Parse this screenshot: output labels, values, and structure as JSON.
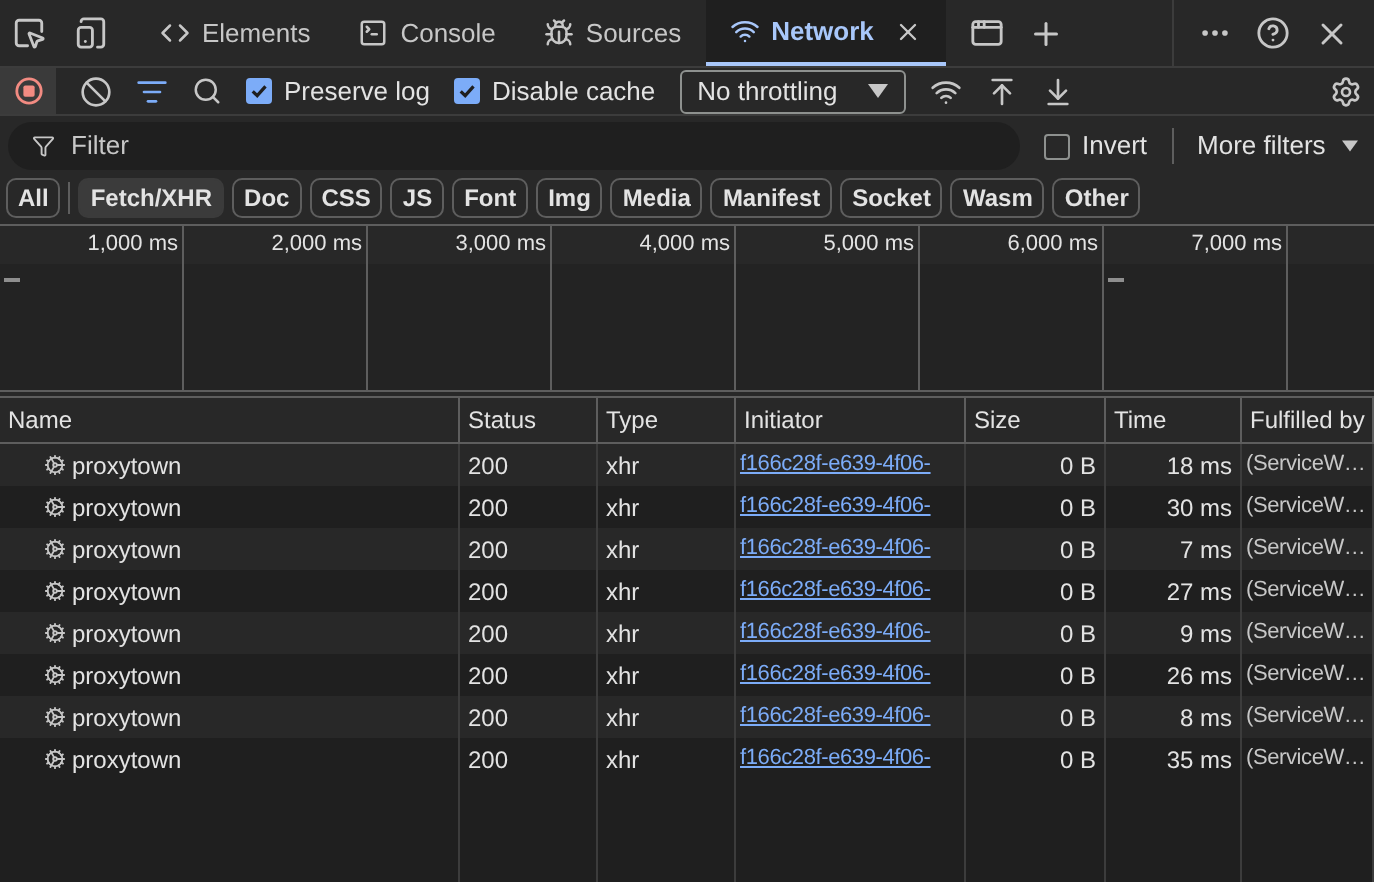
{
  "tabs": [
    {
      "label": "Elements",
      "kind": "code",
      "selected": false
    },
    {
      "label": "Console",
      "kind": "console",
      "selected": false
    },
    {
      "label": "Sources",
      "kind": "bug",
      "selected": false
    },
    {
      "label": "Network",
      "kind": "wifi",
      "selected": true,
      "closable": true
    }
  ],
  "toolbar": {
    "recording": true,
    "preserve_log": {
      "label": "Preserve log",
      "checked": true
    },
    "disable_cache": {
      "label": "Disable cache",
      "checked": true
    },
    "throttling": {
      "value": "No throttling"
    }
  },
  "filter": {
    "placeholder": "Filter",
    "invert": {
      "label": "Invert",
      "checked": false
    },
    "more_filters": "More filters"
  },
  "type_filters": [
    {
      "label": "All",
      "selected": false
    },
    {
      "label": "Fetch/XHR",
      "selected": true
    },
    {
      "label": "Doc",
      "selected": false
    },
    {
      "label": "CSS",
      "selected": false
    },
    {
      "label": "JS",
      "selected": false
    },
    {
      "label": "Font",
      "selected": false
    },
    {
      "label": "Img",
      "selected": false
    },
    {
      "label": "Media",
      "selected": false
    },
    {
      "label": "Manifest",
      "selected": false
    },
    {
      "label": "Socket",
      "selected": false
    },
    {
      "label": "Wasm",
      "selected": false
    },
    {
      "label": "Other",
      "selected": false
    }
  ],
  "timeline": {
    "ticks": [
      "1,000 ms",
      "2,000 ms",
      "3,000 ms",
      "4,000 ms",
      "5,000 ms",
      "6,000 ms",
      "7,000 ms"
    ]
  },
  "table": {
    "columns": [
      "Name",
      "Status",
      "Type",
      "Initiator",
      "Size",
      "Time",
      "Fulfilled by"
    ],
    "rows": [
      [
        "proxytown",
        "200",
        "xhr",
        "f166c28f-e639-4f06-",
        "0 B",
        "18 ms",
        "(ServiceW…"
      ],
      [
        "proxytown",
        "200",
        "xhr",
        "f166c28f-e639-4f06-",
        "0 B",
        "30 ms",
        "(ServiceW…"
      ],
      [
        "proxytown",
        "200",
        "xhr",
        "f166c28f-e639-4f06-",
        "0 B",
        "7 ms",
        "(ServiceW…"
      ],
      [
        "proxytown",
        "200",
        "xhr",
        "f166c28f-e639-4f06-",
        "0 B",
        "27 ms",
        "(ServiceW…"
      ],
      [
        "proxytown",
        "200",
        "xhr",
        "f166c28f-e639-4f06-",
        "0 B",
        "9 ms",
        "(ServiceW…"
      ],
      [
        "proxytown",
        "200",
        "xhr",
        "f166c28f-e639-4f06-",
        "0 B",
        "26 ms",
        "(ServiceW…"
      ],
      [
        "proxytown",
        "200",
        "xhr",
        "f166c28f-e639-4f06-",
        "0 B",
        "8 ms",
        "(ServiceW…"
      ],
      [
        "proxytown",
        "200",
        "xhr",
        "f166c28f-e639-4f06-",
        "0 B",
        "35 ms",
        "(ServiceW…"
      ]
    ]
  }
}
